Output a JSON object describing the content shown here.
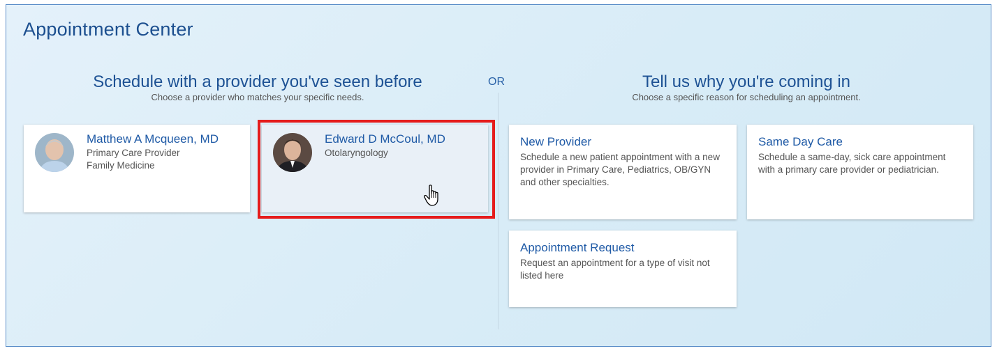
{
  "page_title": "Appointment Center",
  "left_section": {
    "title": "Schedule with a provider you've seen before",
    "subtitle": "Choose a provider who matches your specific needs."
  },
  "or_label": "OR",
  "right_section": {
    "title": "Tell us why you're coming in",
    "subtitle": "Choose a specific reason for scheduling an appointment."
  },
  "providers": [
    {
      "name": "Matthew A Mcqueen, MD",
      "line1": "Primary Care Provider",
      "line2": "Family Medicine"
    },
    {
      "name": "Edward D McCoul, MD",
      "line1": "Otolaryngology",
      "line2": ""
    }
  ],
  "reasons": [
    {
      "title": "New Provider",
      "description": "Schedule a new patient appointment with a new provider in Primary Care, Pediatrics, OB/GYN and other specialties."
    },
    {
      "title": "Same Day Care",
      "description": "Schedule a same-day, sick care appointment with a primary care provider or pediatrician."
    },
    {
      "title": "Appointment Request",
      "description": "Request an appointment for a type of visit not listed here"
    }
  ],
  "colors": {
    "highlight": "#e51c1c",
    "link": "#1f5aa6",
    "heading": "#1c4f8f"
  },
  "icons": {
    "cursor": "hand-pointer-icon"
  }
}
